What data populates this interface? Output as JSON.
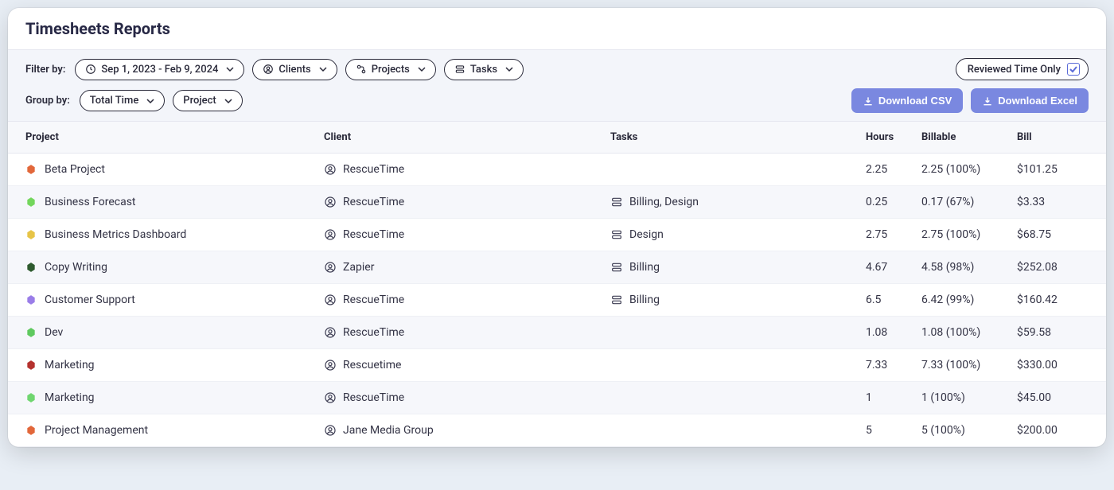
{
  "title": "Timesheets Reports",
  "filters": {
    "label": "Filter by:",
    "date_range": "Sep 1, 2023 - Feb 9, 2024",
    "clients": "Clients",
    "projects": "Projects",
    "tasks": "Tasks",
    "reviewed_label": "Reviewed Time Only"
  },
  "group": {
    "label": "Group by:",
    "total_time": "Total Time",
    "project": "Project"
  },
  "buttons": {
    "csv": "Download CSV",
    "excel": "Download Excel"
  },
  "columns": {
    "project": "Project",
    "client": "Client",
    "tasks": "Tasks",
    "hours": "Hours",
    "billable": "Billable",
    "bill": "Bill"
  },
  "rows": [
    {
      "color": "#e2673a",
      "project": "Beta Project",
      "client": "RescueTime",
      "tasks": "",
      "hours": "2.25",
      "billable": "2.25 (100%)",
      "bill": "$101.25"
    },
    {
      "color": "#73d65c",
      "project": "Business Forecast",
      "client": "RescueTime",
      "tasks": "Billing, Design",
      "hours": "0.25",
      "billable": "0.17 (67%)",
      "bill": "$3.33"
    },
    {
      "color": "#e7c447",
      "project": "Business Metrics Dashboard",
      "client": "RescueTime",
      "tasks": "Design",
      "hours": "2.75",
      "billable": "2.75 (100%)",
      "bill": "$68.75"
    },
    {
      "color": "#2e5a2e",
      "project": "Copy Writing",
      "client": "Zapier",
      "tasks": "Billing",
      "hours": "4.67",
      "billable": "4.58 (98%)",
      "bill": "$252.08"
    },
    {
      "color": "#9a7de8",
      "project": "Customer Support",
      "client": "RescueTime",
      "tasks": "Billing",
      "hours": "6.5",
      "billable": "6.42 (99%)",
      "bill": "$160.42"
    },
    {
      "color": "#5fc95f",
      "project": "Dev",
      "client": "RescueTime",
      "tasks": "",
      "hours": "1.08",
      "billable": "1.08 (100%)",
      "bill": "$59.58"
    },
    {
      "color": "#b5322e",
      "project": "Marketing",
      "client": "Rescuetime",
      "tasks": "",
      "hours": "7.33",
      "billable": "7.33 (100%)",
      "bill": "$330.00"
    },
    {
      "color": "#6fd66f",
      "project": "Marketing",
      "client": "RescueTime",
      "tasks": "",
      "hours": "1",
      "billable": "1 (100%)",
      "bill": "$45.00"
    },
    {
      "color": "#e2673a",
      "project": "Project Management",
      "client": "Jane Media Group",
      "tasks": "",
      "hours": "5",
      "billable": "5 (100%)",
      "bill": "$200.00"
    }
  ]
}
